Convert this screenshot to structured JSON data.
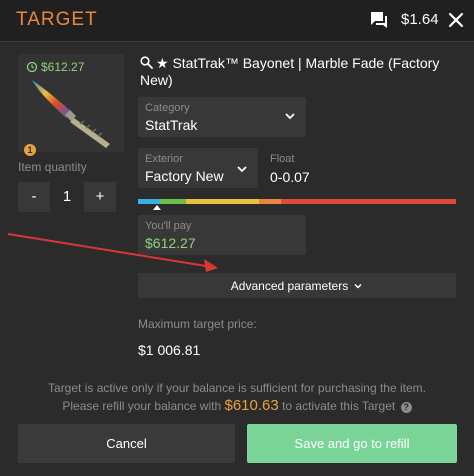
{
  "header": {
    "title": "TARGET",
    "balance": "$1.64",
    "icons": {
      "chat": "chat-icon",
      "close": "close-icon"
    }
  },
  "item": {
    "price": "$612.27",
    "quantity_badge": "1",
    "name": "★ StatTrak™ Bayonet | Marble Fade (Factory New)",
    "icons": {
      "price": "refresh-coin-icon",
      "search": "search-icon"
    }
  },
  "quantity": {
    "label": "Item quantity",
    "minus": "-",
    "value": "1",
    "plus": "+"
  },
  "category": {
    "label": "Category",
    "value": "StatTrak"
  },
  "exterior": {
    "label": "Exterior",
    "value": "Factory New"
  },
  "float": {
    "label": "Float",
    "value": "0-0.07"
  },
  "wear_bar": {
    "segments": [
      {
        "color": "#3ab0e0",
        "fraction": 0.07
      },
      {
        "color": "#6bc04a",
        "fraction": 0.08
      },
      {
        "color": "#e8c13d",
        "fraction": 0.23
      },
      {
        "color": "#e8873d",
        "fraction": 0.07
      },
      {
        "color": "#e04a3a",
        "fraction": 0.55
      }
    ],
    "pointer_fraction": 0.06
  },
  "pay": {
    "label": "You'll pay",
    "value": "$612.27"
  },
  "advanced": {
    "label": "Advanced parameters"
  },
  "max_target": {
    "label": "Maximum target price:",
    "value": "$1 006.81"
  },
  "notice": {
    "line1": "Target is active only if your balance is sufficient for purchasing the item.",
    "line2_prefix": "Please refill your balance with",
    "amount": "$610.63",
    "line2_suffix": "to activate this Target"
  },
  "buttons": {
    "cancel": "Cancel",
    "save": "Save and go to refill"
  },
  "colors": {
    "accent": "#e8873d",
    "price_green": "#8fd47a",
    "refill_amount": "#e8a23d",
    "save_button": "#7ad497",
    "annotation_arrow": "#d93636"
  }
}
